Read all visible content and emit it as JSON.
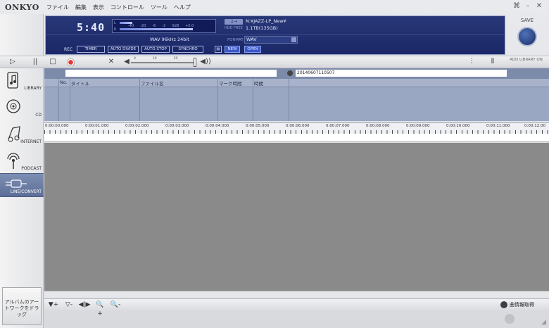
{
  "app": {
    "logo": "ONKYO",
    "menu": [
      "ファイル",
      "編集",
      "表示",
      "コントロール",
      "ツール",
      "ヘルプ"
    ],
    "window_controls": [
      "⌘",
      "–",
      "✕"
    ]
  },
  "sidebar": {
    "items": [
      {
        "label": "LIBRARY",
        "icon": "music-note-icon"
      },
      {
        "label": "CD",
        "icon": "cd-disc-icon"
      },
      {
        "label": "INTERNET",
        "icon": "internet-music-icon"
      },
      {
        "label": "PODCAST",
        "icon": "podcast-antenna-icon"
      },
      {
        "label": "LINE/CONVERT",
        "icon": "line-cable-icon"
      }
    ],
    "art_drop": "アルバムのアートワークをドラッグ"
  },
  "display": {
    "clock": "5:40",
    "meter_scale": [
      "-40",
      "-20",
      "-6",
      "-2",
      "0dB",
      "+0.0"
    ],
    "meter_channels": [
      "L",
      "R"
    ],
    "folder_path": "N:¥JAZZ-LP_New¥",
    "free_label": "HDD FREE",
    "free_space": "1.1TB(135GB)",
    "format_info": "WAV   96kHz     24bit",
    "format_label": "FORMAT",
    "format_value": "WAV",
    "rec_label": "REC",
    "buttons": [
      "TIMER",
      "AUTO DIVIDE",
      "AUTO STOP",
      "SYNCHRO"
    ],
    "new_label": "NEW",
    "open_label": "OPEN"
  },
  "save": {
    "label": "SAVE"
  },
  "transport": {
    "volume_scale": [
      "0",
      "10",
      "20"
    ],
    "add_library": "ADD LIBRARY ON"
  },
  "list": {
    "filename": "20140607110507",
    "columns": [
      "No.",
      "タイトル",
      "ファイル名",
      "マーク時間",
      "時間"
    ]
  },
  "timeline": {
    "labels": [
      "0:00:00.000",
      "0:00:01.000",
      "0:00:02.000",
      "0:00:03.000",
      "0:00:04.000",
      "0:00:05.000",
      "0:00:06.000",
      "0:00:07.000",
      "0:00:08.000",
      "0:00:09.000",
      "0:00:10.000",
      "0:00:11.000",
      "0:00:12.00"
    ]
  },
  "bottom": {
    "info_button": "曲情報取得"
  },
  "colors": {
    "display_bg": "#1b2868",
    "active_nav": "#6677a0",
    "waveform_bg": "#8a8a8a",
    "list_bg": "#9aa7c2"
  }
}
